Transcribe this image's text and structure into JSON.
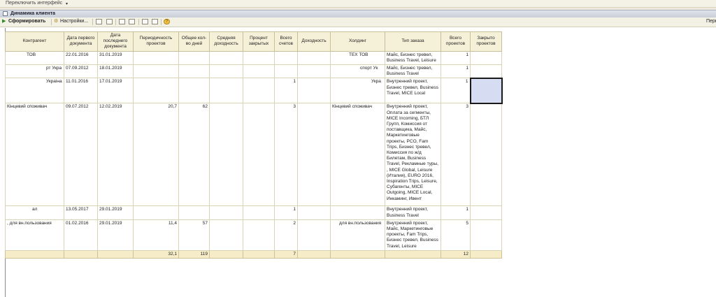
{
  "topbar": {
    "label": "Переключить интерфейс"
  },
  "window": {
    "title": "Динамика клиента"
  },
  "toolbar": {
    "generate_label": "Сформировать",
    "settings_label": "Настройки...",
    "right_label": "Перв"
  },
  "table": {
    "headers": [
      "Контрагент",
      "Дата первого документа",
      "Дата последнего документа",
      "Периодичность проектов",
      "Общее кол-во дней",
      "Средняя доходность",
      "Процент закрытых",
      "Всего счетов",
      "Доходность",
      "Холдинг",
      "Тип заказа",
      "Всего проектов",
      "Закрыто проектов"
    ],
    "rows": [
      [
        "ТОВ",
        "22.01.2016",
        "31.01.2019",
        "",
        "",
        "",
        "",
        "",
        "",
        "ТЕХ ТОВ",
        "Майс, Бизнес тревел, Business Travel, Leisure",
        "1",
        ""
      ],
      [
        "рт Укра",
        "07.09.2012",
        "18.01.2019",
        "",
        "",
        "",
        "",
        "",
        "",
        "спорт Ук",
        "Майс, Бизнес тревел, Business Travel",
        "1",
        ""
      ],
      [
        "Украіна",
        "11.01.2016",
        "17.01.2019",
        "",
        "",
        "",
        "",
        "1",
        "",
        "Укра",
        "Внутренний проект, Бизнес тревел, Business Travel, MICE Local",
        "1",
        ""
      ],
      [
        "Кінцевий споживач",
        "09.07.2012",
        "12.02.2019",
        "20,7",
        "62",
        "",
        "",
        "3",
        "",
        "Кінцевий споживач",
        "Внутренний проект, Оплата за сегменты, MICE Incoming, БТЛ Групп, Комиссия от поставщика, Майс, Маркетинговые проекты, PCO, Fam Trips, Бизнес тревел, Комиссия по ж/д Билетам, Business Travel, Рекламные туры, , MICE Global, Leisure (Италия), EURO 2016, Inspiration Trips, Leisure, Субагенты, MICE Outgoing, MICE Local, Инкаминг, Ивент",
        "3",
        ""
      ],
      [
        "ал",
        "13.05.2017",
        "29.01.2019",
        "",
        "",
        "",
        "",
        "1",
        "",
        "",
        "Внутренний проект, Business Travel",
        "1",
        ""
      ],
      [
        ", для вн.пользования",
        "01.02.2016",
        "29.01.2019",
        "11,4",
        "57",
        "",
        "",
        "2",
        "",
        "для вн.пользования",
        "Внутренний проект, Майс, Маркетинговые проекты, Fam Trips, Бизнес тревел, Business Travel, Leisure",
        "5",
        ""
      ]
    ],
    "totals": [
      "",
      "",
      "",
      "32,1",
      "119",
      "",
      "",
      "7",
      "",
      "",
      "",
      "12",
      ""
    ]
  }
}
